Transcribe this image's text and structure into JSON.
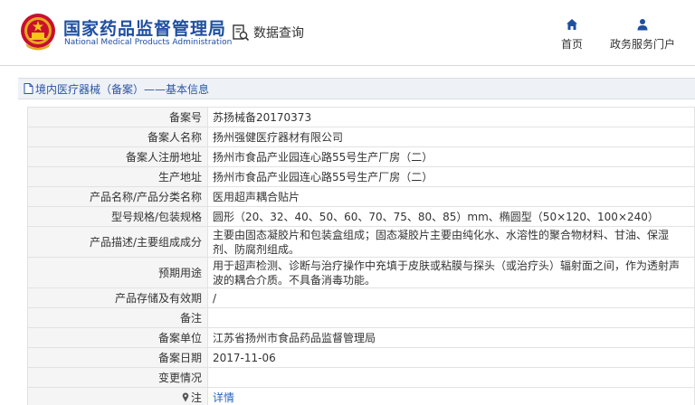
{
  "header": {
    "site_title": "国家药品监督管理局",
    "site_subtitle": "National Medical Products Administration",
    "search_label": "数据查询",
    "nav_home": "首页",
    "nav_portal": "政务服务门户"
  },
  "breadcrumb": {
    "text": "境内医疗器械（备案）——基本信息"
  },
  "rows": [
    {
      "label": "备案号",
      "value": "苏扬械备20170373"
    },
    {
      "label": "备案人名称",
      "value": "扬州强健医疗器材有限公司"
    },
    {
      "label": "备案人注册地址",
      "value": "扬州市食品产业园连心路55号生产厂房（二）"
    },
    {
      "label": "生产地址",
      "value": "扬州市食品产业园连心路55号生产厂房（二）"
    },
    {
      "label": "产品名称/产品分类名称",
      "value": "医用超声耦合贴片"
    },
    {
      "label": "型号规格/包装规格",
      "value": "圆形（20、32、40、50、60、70、75、80、85）mm、椭圆型（50×120、100×240）"
    },
    {
      "label": "产品描述/主要组成成分",
      "value": "主要由固态凝胶片和包装盒组成；固态凝胶片主要由纯化水、水溶性的聚合物材料、甘油、保湿剂、防腐剂组成。"
    },
    {
      "label": "预期用途",
      "value": "用于超声检测、诊断与治疗操作中充填于皮肤或粘膜与探头（或治疗头）辐射面之间，作为透射声波的耦合介质。不具备消毒功能。"
    },
    {
      "label": "产品存储及有效期",
      "value": "/"
    },
    {
      "label": "备注",
      "value": ""
    },
    {
      "label": "备案单位",
      "value": "江苏省扬州市食品药品监督管理局"
    },
    {
      "label": "备案日期",
      "value": "2017-11-06"
    },
    {
      "label": "变更情况",
      "value": ""
    },
    {
      "label": "注",
      "value": "详情"
    }
  ]
}
